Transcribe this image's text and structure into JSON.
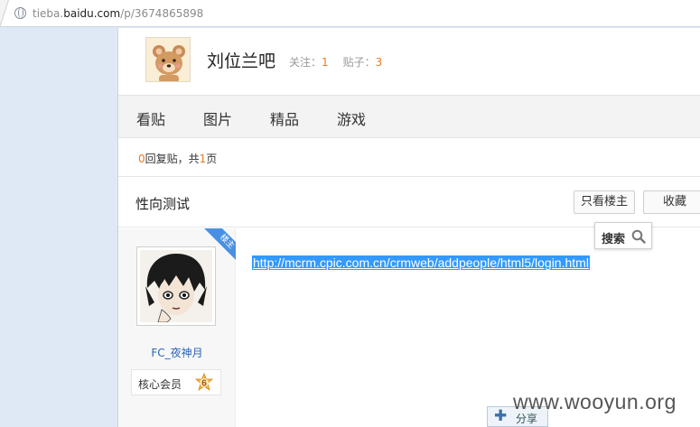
{
  "address_bar": {
    "host_prefix": "tieba.",
    "host_main": "baidu.com",
    "path": "/p/3674865898"
  },
  "forum": {
    "name": "刘位兰吧",
    "follow_label": "关注：",
    "follow_count": "1",
    "posts_label": "贴子：",
    "posts_count": "3"
  },
  "nav": {
    "tabs": [
      "看贴",
      "图片",
      "精品",
      "游戏"
    ]
  },
  "thread": {
    "reply_count": "0",
    "reply_text": "回复贴，共",
    "page_count": "1",
    "page_unit": "页",
    "title": "性向测试",
    "only_op_button": "只看楼主",
    "favorite_button": "收藏"
  },
  "post": {
    "corner_badge": "楼主",
    "author_name": "FC_夜神月",
    "member_label": "核心会员",
    "member_level": "6",
    "content_link": "http://mcrm.cpic.com.cn/crmweb/addpeople/html5/login.html"
  },
  "floating_search": {
    "label": "搜索"
  },
  "share": {
    "label": "分享"
  },
  "watermark": "www.wooyun.org",
  "colors": {
    "accent_orange": "#e57c24",
    "link_blue": "#2d64b3",
    "selection_blue": "#3399ff",
    "ribbon_blue": "#4a90e2"
  }
}
